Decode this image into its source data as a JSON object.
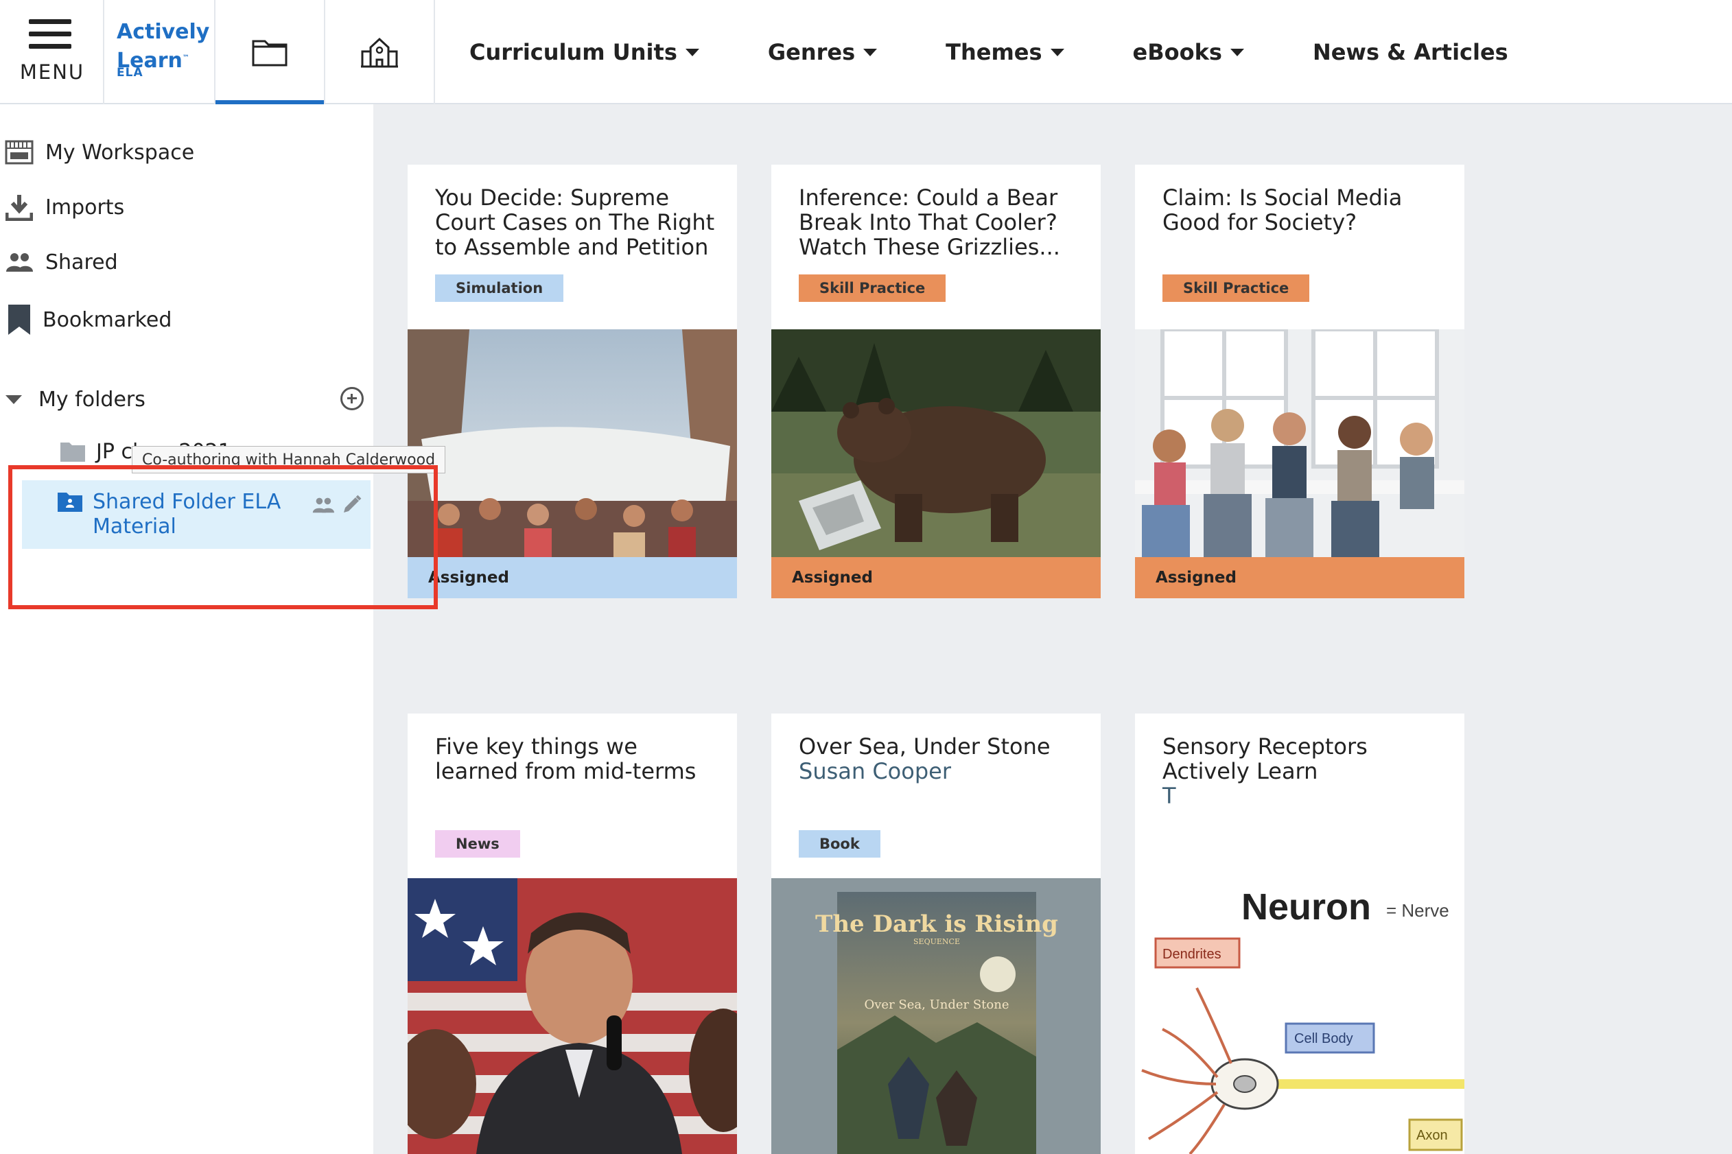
{
  "header": {
    "menu_label": "MENU",
    "logo_line1": "Actively",
    "logo_line2": "Learn",
    "logo_tm": "™",
    "logo_sub": "ELA",
    "nav": [
      {
        "label": "Curriculum Units",
        "has_caret": true
      },
      {
        "label": "Genres",
        "has_caret": true
      },
      {
        "label": "Themes",
        "has_caret": true
      },
      {
        "label": "eBooks",
        "has_caret": true
      },
      {
        "label": "News & Articles",
        "has_caret": false
      }
    ]
  },
  "sidebar": {
    "items": [
      {
        "label": "My Workspace",
        "icon": "workspace-icon"
      },
      {
        "label": "Imports",
        "icon": "download-icon"
      },
      {
        "label": "Shared",
        "icon": "people-icon"
      },
      {
        "label": "Bookmarked",
        "icon": "bookmark-icon"
      }
    ],
    "folders_label": "My folders",
    "folder": "JP class 2021",
    "shared_folder": "Shared Folder ELA Material",
    "tooltip": "Co-authoring with Hannah Calderwood"
  },
  "cards": [
    {
      "title": "You Decide: Supreme Court Cases on The Right to Assemble and Petition",
      "subtitle": "",
      "badge": "Simulation",
      "footer": "Assigned"
    },
    {
      "title": "Inference: Could a Bear Break Into That Cooler? Watch These Grizzlies...",
      "subtitle": "",
      "badge": "Skill Practice",
      "footer": "Assigned"
    },
    {
      "title": "Claim: Is Social Media Good for Society?",
      "subtitle": "",
      "badge": "Skill Practice",
      "footer": "Assigned"
    },
    {
      "title": "Five key things we learned from mid-terms",
      "subtitle": "",
      "badge": "News",
      "footer": ""
    },
    {
      "title": "Over Sea, Under Stone",
      "subtitle": "Susan Cooper",
      "badge": "Book",
      "footer": ""
    },
    {
      "title": "Sensory Receptors",
      "subtitle": "Actively Learn",
      "subtitle2": "T",
      "badge": "",
      "footer": ""
    }
  ],
  "images": {
    "book_cover_title": "The Dark is Rising",
    "book_cover_seq": "SEQUENCE",
    "book_cover_sub": "Over Sea, Under Stone",
    "neuron_title": "Neuron",
    "neuron_eq": "= Nerve",
    "neuron_dendrites": "Dendrites",
    "neuron_cellbody": "Cell Body",
    "neuron_axon": "Axon"
  },
  "colors": {
    "accent": "#1f6fc4",
    "simulation": "#b9d6f2",
    "skill_practice": "#e9905a",
    "news": "#f1cdf0",
    "book": "#b9d6f2",
    "highlight": "#e8392a"
  }
}
